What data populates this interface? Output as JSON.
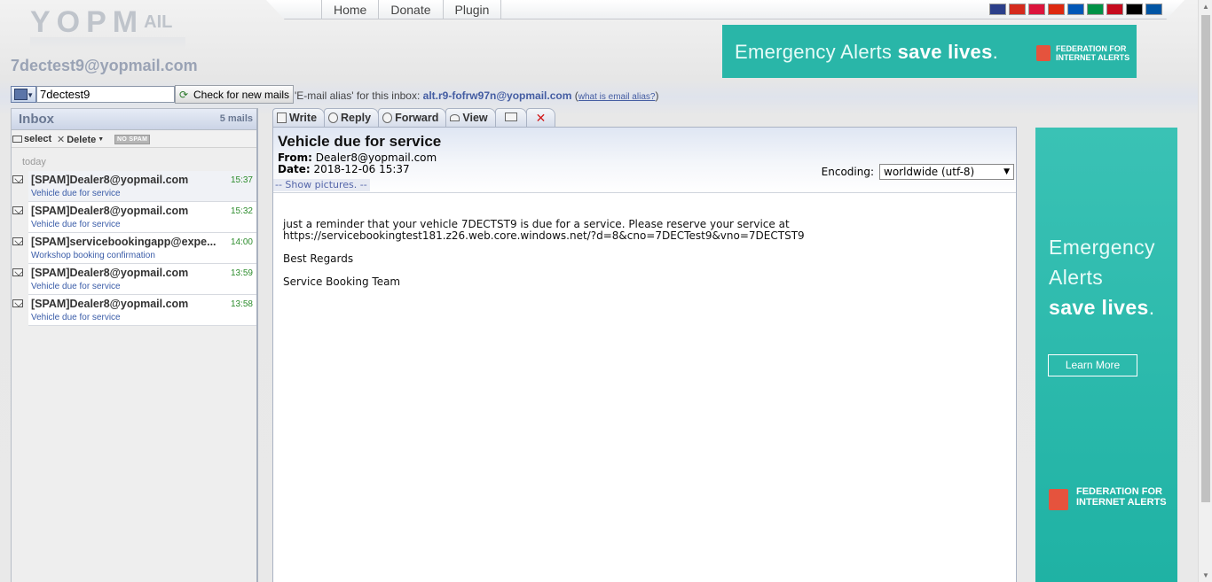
{
  "logo": {
    "text_main": "YOPM",
    "text_small": "AIL"
  },
  "user_email": "7dectest9@yopmail.com",
  "nav": {
    "home": "Home",
    "donate": "Donate",
    "plugin": "Plugin"
  },
  "flags": [
    {
      "name": "uk-flag-icon",
      "color": "#2b3f8a"
    },
    {
      "name": "russia-flag-icon",
      "color": "#d52b1e"
    },
    {
      "name": "poland-flag-icon",
      "color": "#dc143c"
    },
    {
      "name": "china-flag-icon",
      "color": "#de2910"
    },
    {
      "name": "ukraine-flag-icon",
      "color": "#0057b7"
    },
    {
      "name": "italy-flag-icon",
      "color": "#009246"
    },
    {
      "name": "spain-flag-icon",
      "color": "#c60b1e"
    },
    {
      "name": "germany-flag-icon",
      "color": "#000000"
    },
    {
      "name": "france-flag-icon",
      "color": "#0055a4"
    }
  ],
  "ad_top": {
    "text_a": "Emergency Alerts ",
    "text_b": "save lives",
    "dot": ".",
    "fed1": "FEDERATION FOR",
    "fed2": "INTERNET ALERTS"
  },
  "alias_bar": {
    "login_value": "7dectest9",
    "check_label": "Check for new mails",
    "alias_prefix": "'E-mail alias' for this inbox: ",
    "alias_value": "alt.r9-fofrw97n@yopmail.com",
    "alias_open": " (",
    "alias_link": "what is email alias?",
    "alias_close": ")"
  },
  "inbox": {
    "title": "Inbox",
    "count": "5 mails",
    "select_label": "select",
    "delete_label": "Delete",
    "nospam_label": "NO SPAM",
    "day_label": "today",
    "messages": [
      {
        "from": "[SPAM]Dealer8@yopmail.com",
        "time": "15:37",
        "subject": "Vehicle due for service"
      },
      {
        "from": "[SPAM]Dealer8@yopmail.com",
        "time": "15:32",
        "subject": "Vehicle due for service"
      },
      {
        "from": "[SPAM]servicebookingapp@expe...",
        "time": "14:00",
        "subject": "Workshop booking confirmation"
      },
      {
        "from": "[SPAM]Dealer8@yopmail.com",
        "time": "13:59",
        "subject": "Vehicle due for service"
      },
      {
        "from": "[SPAM]Dealer8@yopmail.com",
        "time": "13:58",
        "subject": "Vehicle due for service"
      }
    ]
  },
  "toolbar": {
    "write": "Write",
    "reply": "Reply",
    "forward": "Forward",
    "view": "View"
  },
  "mail": {
    "subject": "Vehicle due for service",
    "from_label": "From:",
    "from_value": " Dealer8@yopmail.com",
    "date_label": "Date:",
    "date_value": " 2018-12-06 15:37",
    "show_pictures": "-- Show pictures. --",
    "encoding_label": "Encoding:",
    "encoding_value": "worldwide (utf-8)",
    "body_line1": "just a reminder that your vehicle 7DECTST9 is due for a service. Please reserve your service at",
    "body_line2": "https://servicebookingtest181.z26.web.core.windows.net/?d=8&cno=7DECTest9&vno=7DECTST9",
    "body_line3": "Best Regards",
    "body_line4": "Service Booking Team"
  },
  "ad_side": {
    "l1": "Emergency",
    "l2": "Alerts",
    "l3": "save lives",
    "dot": ".",
    "learn_more": "Learn More",
    "fed1": "FEDERATION FOR",
    "fed2": "INTERNET ALERTS"
  }
}
